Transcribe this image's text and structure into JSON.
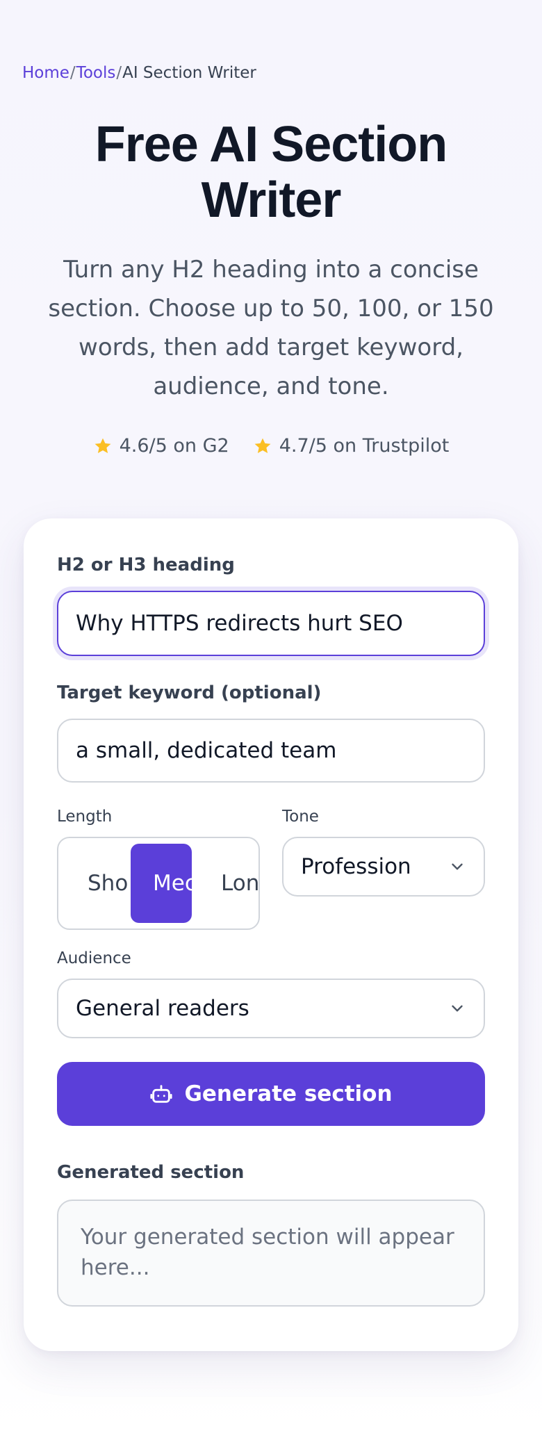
{
  "breadcrumb": {
    "home": "Home",
    "sep1": "/",
    "tools": "Tools",
    "sep2": "/",
    "current": "AI Section Writer"
  },
  "hero": {
    "title": "Free AI Section Writer",
    "subtitle": "Turn any H2 heading into a concise section. Choose up to 50, 100, or 150 words, then add target keyword, audience, and tone."
  },
  "ratings": [
    {
      "text": "4.6/5 on G2",
      "icon": "star-icon"
    },
    {
      "text": "4.7/5 on Trustpilot",
      "icon": "star-icon"
    }
  ],
  "form": {
    "heading_label": "H2 or H3 heading",
    "heading_value": "Why HTTPS redirects hurt SEO",
    "keyword_label": "Target keyword (optional)",
    "keyword_value": "a small, dedicated team",
    "length_label": "Length",
    "length_options": [
      "Short",
      "Medium",
      "Long"
    ],
    "length_options_visible": [
      "Sho",
      "Mec",
      "Long"
    ],
    "length_selected": "Medium",
    "tone_label": "Tone",
    "tone_value": "Profession",
    "audience_label": "Audience",
    "audience_value": "General readers",
    "generate_label": "Generate section",
    "output_label": "Generated section",
    "output_placeholder": "Your generated section will appear here..."
  },
  "colors": {
    "accent": "#5b3fd9",
    "star": "#fbbf24",
    "text": "#111827",
    "muted": "#4b5563"
  }
}
